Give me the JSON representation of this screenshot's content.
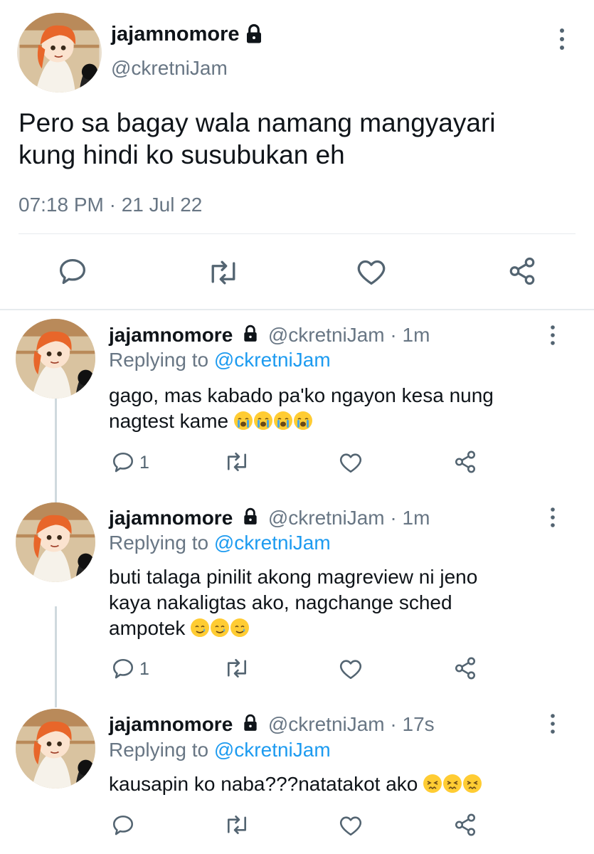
{
  "main_tweet": {
    "display_name": "jajamnomore",
    "handle": "@ckretniJam",
    "text_line1": "Pero sa bagay wala namang mangyayari",
    "text_line2": "kung hindi ko susubukan eh",
    "timestamp": "07:18 PM · 21 Jul 22"
  },
  "replies": [
    {
      "display_name": "jajamnomore",
      "handle_time": "@ckretniJam · 1m",
      "replying_prefix": "Replying to",
      "replying_handle": "@ckretniJam",
      "text_line1": "gago, mas kabado pa'ko ngayon kesa nung",
      "text_line2": "nagtest kame",
      "emoji": "loudly-crying-face",
      "reply_count": "1"
    },
    {
      "display_name": "jajamnomore",
      "handle_time": "@ckretniJam · 1m",
      "replying_prefix": "Replying to",
      "replying_handle": "@ckretniJam",
      "text_line1": "buti talaga pinilit akong magreview ni jeno",
      "text_line2": "kaya nakaligtas ako, nagchange sched",
      "text_line3": "ampotek",
      "emoji": "smiling-face-with-tear",
      "reply_count": "1"
    },
    {
      "display_name": "jajamnomore",
      "handle_time": "@ckretniJam · 17s",
      "replying_prefix": "Replying to",
      "replying_handle": "@ckretniJam",
      "text_line1": "kausapin ko naba???natatakot ako",
      "emoji": "persevering-face",
      "reply_count": ""
    }
  ],
  "colors": {
    "text": "#0f1419",
    "muted": "#687684",
    "link": "#1d9bf0",
    "icon": "#536471"
  }
}
